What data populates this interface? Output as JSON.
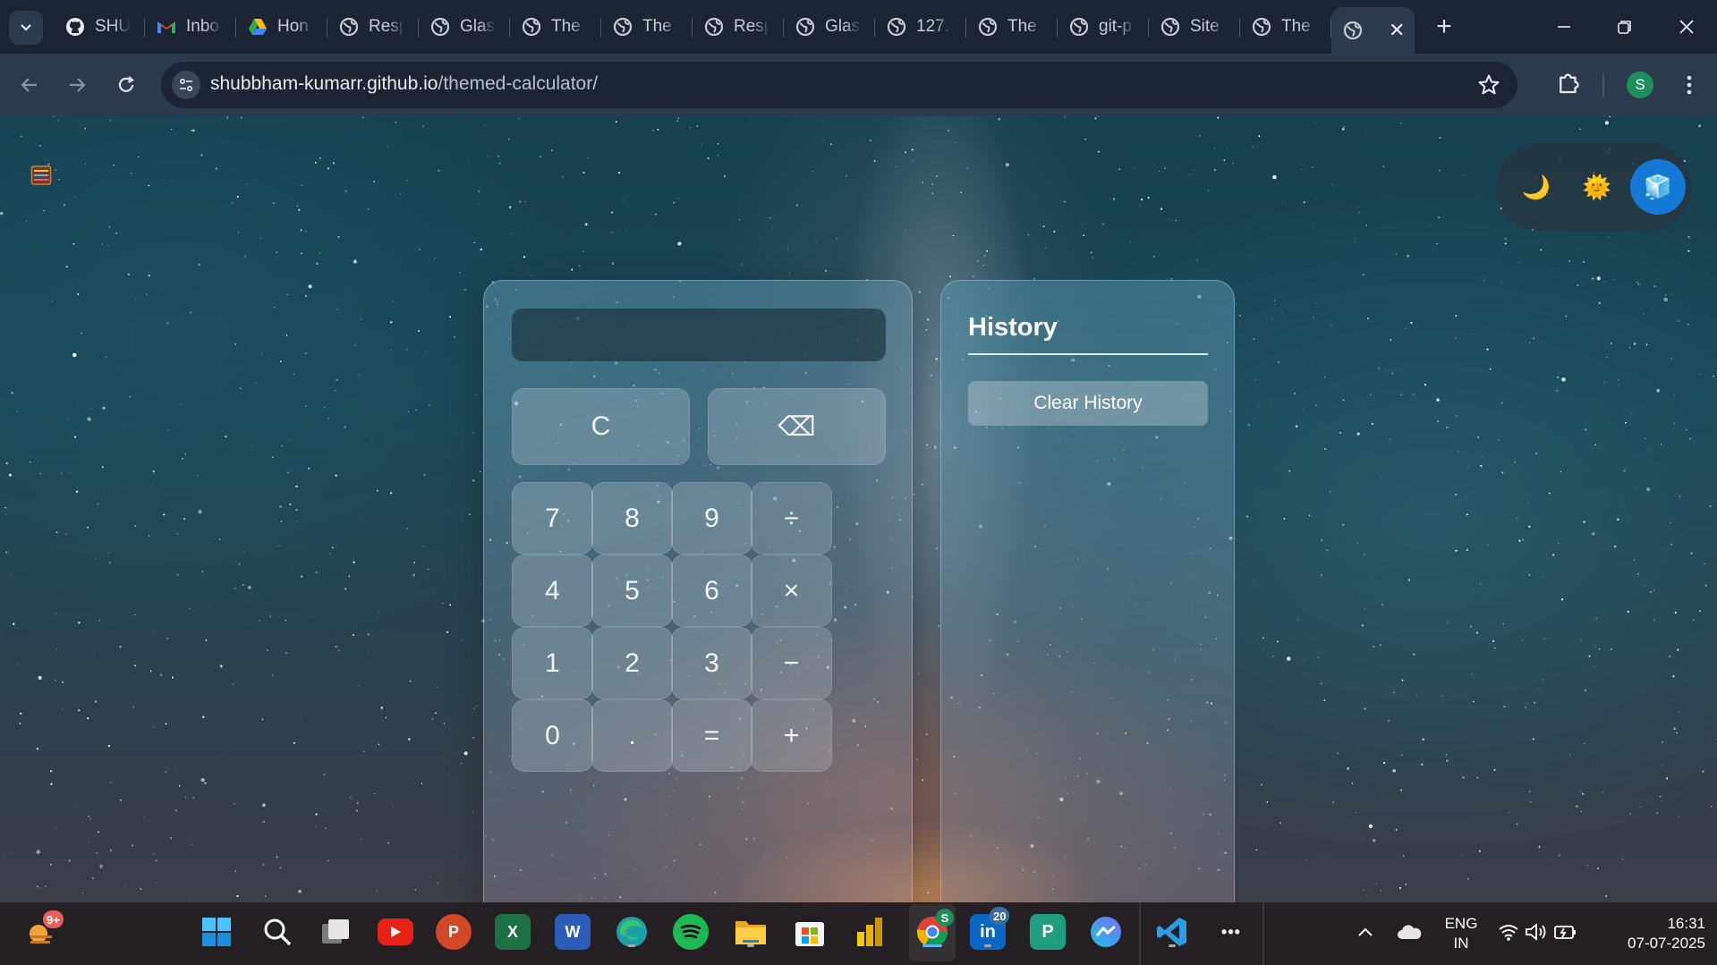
{
  "browser": {
    "tabs": [
      {
        "title": "SHU",
        "icon": "github-icon"
      },
      {
        "title": "Inbo",
        "icon": "gmail-icon"
      },
      {
        "title": "Hon",
        "icon": "google-drive-icon"
      },
      {
        "title": "Resp",
        "icon": "globe-icon"
      },
      {
        "title": "Glas",
        "icon": "globe-icon"
      },
      {
        "title": "The",
        "icon": "globe-icon"
      },
      {
        "title": "The",
        "icon": "globe-icon"
      },
      {
        "title": "Resp",
        "icon": "globe-icon"
      },
      {
        "title": "Glas",
        "icon": "globe-icon"
      },
      {
        "title": "127.",
        "icon": "globe-icon"
      },
      {
        "title": "The",
        "icon": "globe-icon"
      },
      {
        "title": "git-p",
        "icon": "globe-icon"
      },
      {
        "title": "Site",
        "icon": "globe-icon"
      },
      {
        "title": "The",
        "icon": "globe-icon"
      }
    ],
    "active_tab": {
      "title": "",
      "icon": "globe-icon",
      "close": "✕"
    },
    "new_tab": "+",
    "url_host": "shubbham-kumarr.github.io",
    "url_path": "/themed-calculator/",
    "profile_initial": "S"
  },
  "theme_switcher": [
    {
      "name": "dark",
      "glyph": "🌙",
      "selected": false
    },
    {
      "name": "light",
      "glyph": "🌞",
      "selected": false
    },
    {
      "name": "glass",
      "glyph": "🧊",
      "selected": true
    }
  ],
  "calculator": {
    "display": "",
    "clear_label": "C",
    "backspace_label": "⌫",
    "rows": [
      [
        "7",
        "8",
        "9",
        "÷"
      ],
      [
        "4",
        "5",
        "6",
        "×"
      ],
      [
        "1",
        "2",
        "3",
        "−"
      ],
      [
        "0",
        ".",
        "=",
        "+"
      ]
    ]
  },
  "history": {
    "title": "History",
    "clear_label": "Clear History"
  },
  "taskbar": {
    "weather_badge": "9+",
    "linkedin_badge": "20",
    "chrome_badge": "S",
    "more": "•••",
    "lang_line1": "ENG",
    "lang_line2": "IN",
    "time": "16:31",
    "date": "07-07-2025"
  },
  "colors": {
    "tabstrip_bg": "#1b2433",
    "toolbar_bg": "#2c3a4e",
    "accent_blue": "#1478d4",
    "taskbar_bg": "#241f22"
  }
}
